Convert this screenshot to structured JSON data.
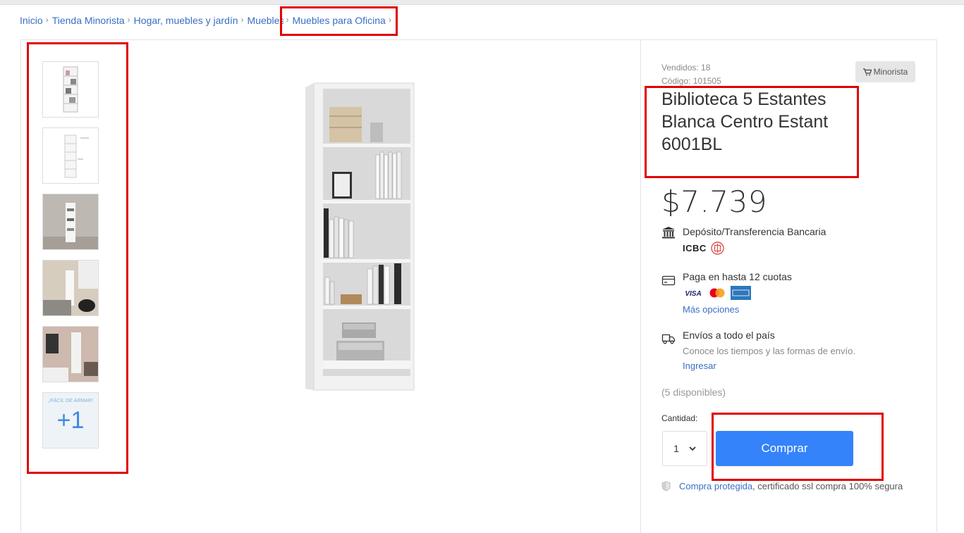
{
  "breadcrumb": {
    "items": [
      "Inicio",
      "Tienda Minorista",
      "Hogar, muebles y jardín",
      "Muebles",
      "Muebles para Oficina"
    ],
    "separator": "›"
  },
  "gallery": {
    "thumbnails": [
      "bookshelf-front",
      "bookshelf-dimensions",
      "bookshelf-room-gray",
      "bookshelf-living-room",
      "bookshelf-bedroom",
      "assembly-instructions"
    ],
    "more_count_label": "+1",
    "assembly_caption": "¡FÁCIL DE ARMAR!"
  },
  "product": {
    "sold": "Vendidos: 18",
    "code": "Código: 101505",
    "store_badge": "Minorista",
    "title": "Biblioteca 5 Estantes Blanca Centro Estant 6001BL",
    "price": "$7.739"
  },
  "payment": {
    "deposit_label": "Depósito/Transferencia Bancaria",
    "bank_name": "ICBC",
    "installments_label": "Paga en hasta 12 cuotas",
    "cards": [
      "VISA",
      "Mastercard",
      "American Express"
    ],
    "more_options": "Más opciones"
  },
  "shipping": {
    "title": "Envíos a todo el país",
    "subtitle": "Conoce los tiempos y las formas de envío.",
    "login_link": "Ingresar"
  },
  "stock": {
    "available": "(5 disponibles)",
    "quantity_label": "Cantidad:",
    "quantity_value": "1"
  },
  "actions": {
    "buy_label": "Comprar"
  },
  "security": {
    "protected_link": "Compra protegida",
    "protected_text": ", certificado ssl compra 100% segura"
  },
  "colors": {
    "accent": "#3483fa",
    "link": "#3a6fc4",
    "highlight": "#e00000"
  }
}
